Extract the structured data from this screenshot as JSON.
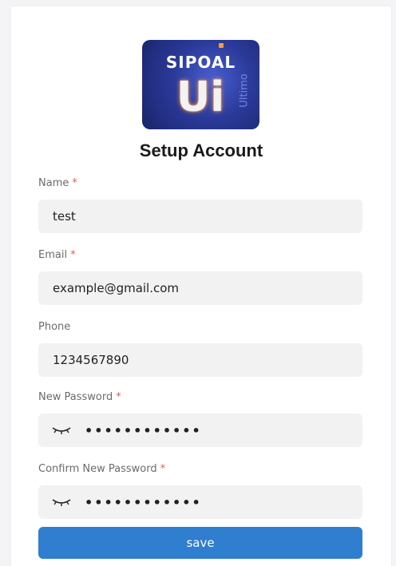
{
  "logo": {
    "brand_text": "SIPOAL",
    "mark_text": "Ui",
    "side_text": "Ultimo"
  },
  "page": {
    "title": "Setup Account"
  },
  "form": {
    "name": {
      "label": "Name",
      "required_mark": "*",
      "value": "test"
    },
    "email": {
      "label": "Email",
      "required_mark": "*",
      "value": "example@gmail.com"
    },
    "phone": {
      "label": "Phone",
      "value": "1234567890"
    },
    "new_password": {
      "label": "New Password",
      "required_mark": "*",
      "masked_value": "••••••••••••"
    },
    "confirm_password": {
      "label": "Confirm New Password",
      "required_mark": "*",
      "masked_value": "••••••••••••"
    },
    "save_label": "save"
  },
  "colors": {
    "accent": "#2f7ecf",
    "required": "#e35a5a",
    "field_bg": "#f2f2f2"
  },
  "icons": {
    "password_toggle": "eye-closed-icon"
  }
}
